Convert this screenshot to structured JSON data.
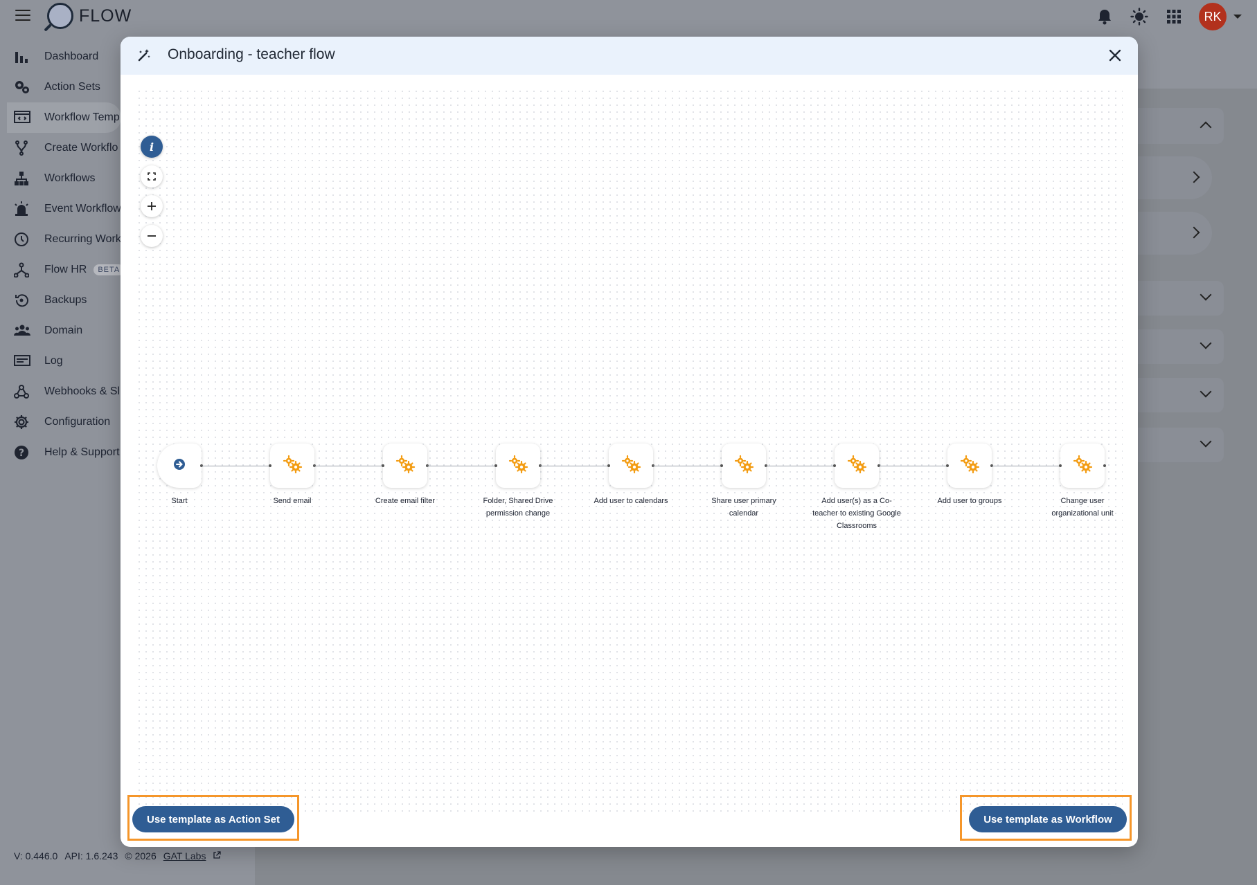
{
  "app": {
    "name": "FLOW",
    "user_initials": "RK"
  },
  "sidebar": {
    "items": [
      {
        "label": "Dashboard",
        "icon": "bar-chart-icon"
      },
      {
        "label": "Action Sets",
        "icon": "gears-icon"
      },
      {
        "label": "Workflow Temp",
        "icon": "template-icon"
      },
      {
        "label": "Create Workflo",
        "icon": "fork-icon"
      },
      {
        "label": "Workflows",
        "icon": "sitemap-icon"
      },
      {
        "label": "Event Workflow",
        "icon": "siren-icon"
      },
      {
        "label": "Recurring Work",
        "icon": "clock-icon"
      },
      {
        "label": "Flow HR",
        "icon": "hr-icon",
        "badge": "BETA"
      },
      {
        "label": "Backups",
        "icon": "restore-icon"
      },
      {
        "label": "Domain",
        "icon": "people-icon"
      },
      {
        "label": "Log",
        "icon": "log-icon"
      },
      {
        "label": "Webhooks & Sl",
        "icon": "webhook-icon"
      },
      {
        "label": "Configuration",
        "icon": "gear-icon"
      },
      {
        "label": "Help & Support",
        "icon": "help-icon"
      }
    ]
  },
  "footer": {
    "version": "V: 0.446.0",
    "api": "API: 1.6.243",
    "copyright": "© 2026",
    "company": "GAT Labs"
  },
  "modal": {
    "title": "Onboarding - teacher flow",
    "controls": [
      "info-icon",
      "fit-view-icon",
      "zoom-in-icon",
      "zoom-out-icon"
    ],
    "nodes": [
      {
        "label": "Start",
        "type": "start"
      },
      {
        "label": "Send email",
        "type": "action"
      },
      {
        "label": "Create email filter",
        "type": "action"
      },
      {
        "label": "Folder, Shared Drive permission change",
        "type": "action"
      },
      {
        "label": "Add user to calendars",
        "type": "action"
      },
      {
        "label": "Share user primary calendar",
        "type": "action"
      },
      {
        "label": "Add user(s) as a Co-teacher to existing Google Classrooms",
        "type": "action"
      },
      {
        "label": "Add user to groups",
        "type": "action"
      },
      {
        "label": "Change user organizational unit",
        "type": "action"
      }
    ],
    "buttons": {
      "action_set": "Use template as Action Set",
      "workflow": "Use template as Workflow"
    }
  },
  "colors": {
    "primary": "#2f5d94",
    "accent": "#f5962a",
    "gear": "#f39c12"
  }
}
